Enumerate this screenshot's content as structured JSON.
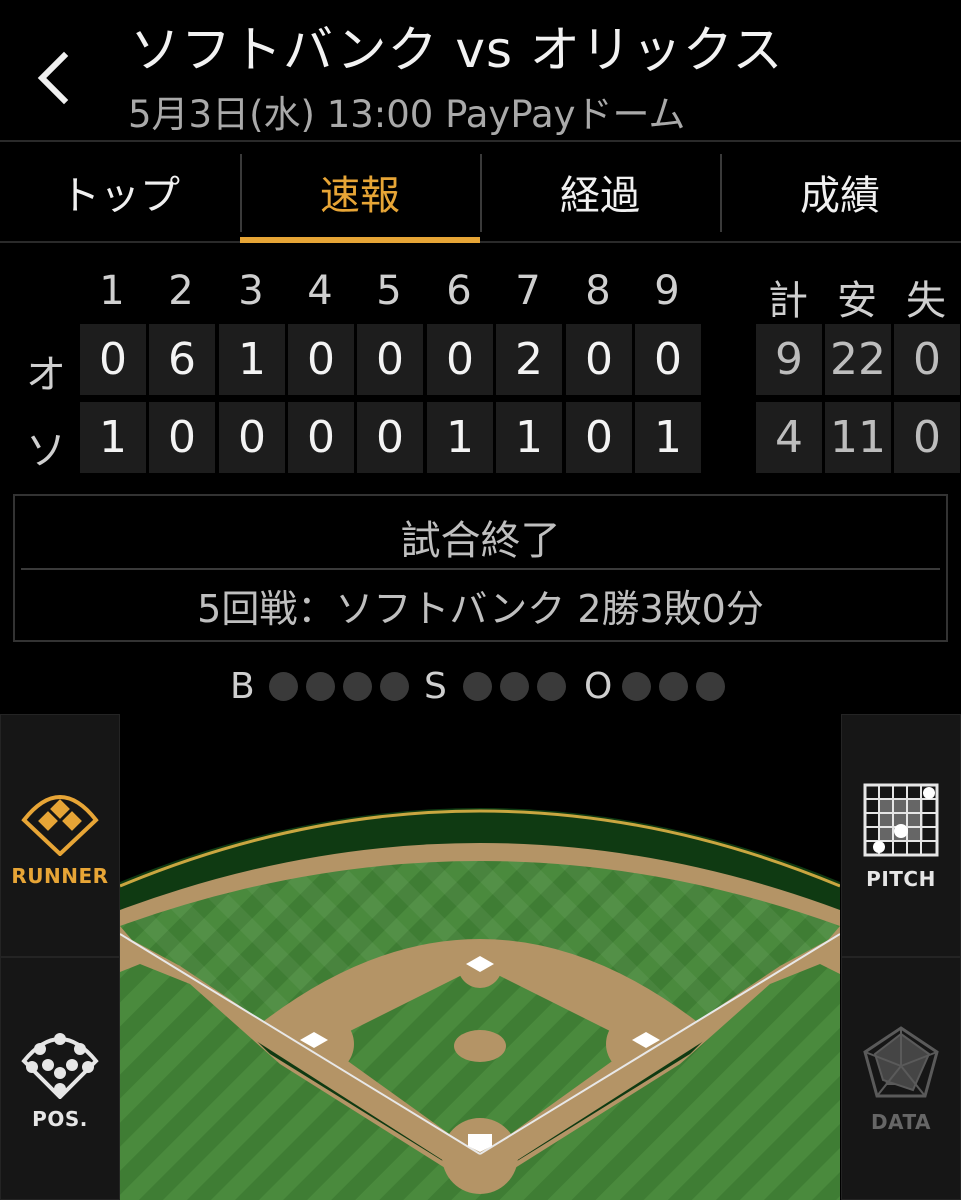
{
  "header": {
    "title": "ソフトバンク vs オリックス",
    "subtitle": "5月3日(水) 13:00 PayPayドーム"
  },
  "tabs": [
    {
      "label": "トップ",
      "active": false
    },
    {
      "label": "速報",
      "active": true
    },
    {
      "label": "経過",
      "active": false
    },
    {
      "label": "成績",
      "active": false
    }
  ],
  "scoreboard": {
    "innings": [
      "1",
      "2",
      "3",
      "4",
      "5",
      "6",
      "7",
      "8",
      "9"
    ],
    "totals_headers": [
      "計",
      "安",
      "失"
    ],
    "teams": [
      {
        "abbr": "オ",
        "innings": [
          "0",
          "6",
          "1",
          "0",
          "0",
          "0",
          "2",
          "0",
          "0"
        ],
        "totals": [
          "9",
          "22",
          "0"
        ]
      },
      {
        "abbr": "ソ",
        "innings": [
          "1",
          "0",
          "0",
          "0",
          "0",
          "1",
          "1",
          "0",
          "1"
        ],
        "totals": [
          "4",
          "11",
          "0"
        ]
      }
    ]
  },
  "status": {
    "state": "試合終了",
    "series": "5回戦：ソフトバンク 2勝3敗0分"
  },
  "count": {
    "ball_label": "B",
    "strike_label": "S",
    "out_label": "O",
    "balls": 0,
    "strikes": 0,
    "outs": 0
  },
  "side_buttons": {
    "runner": "RUNNER",
    "pitch": "PITCH",
    "pos": "POS.",
    "data": "DATA"
  },
  "colors": {
    "accent": "#e7a536",
    "grass": "#3f7d34",
    "dirt": "#b49466",
    "wall": "#0f3a12"
  }
}
